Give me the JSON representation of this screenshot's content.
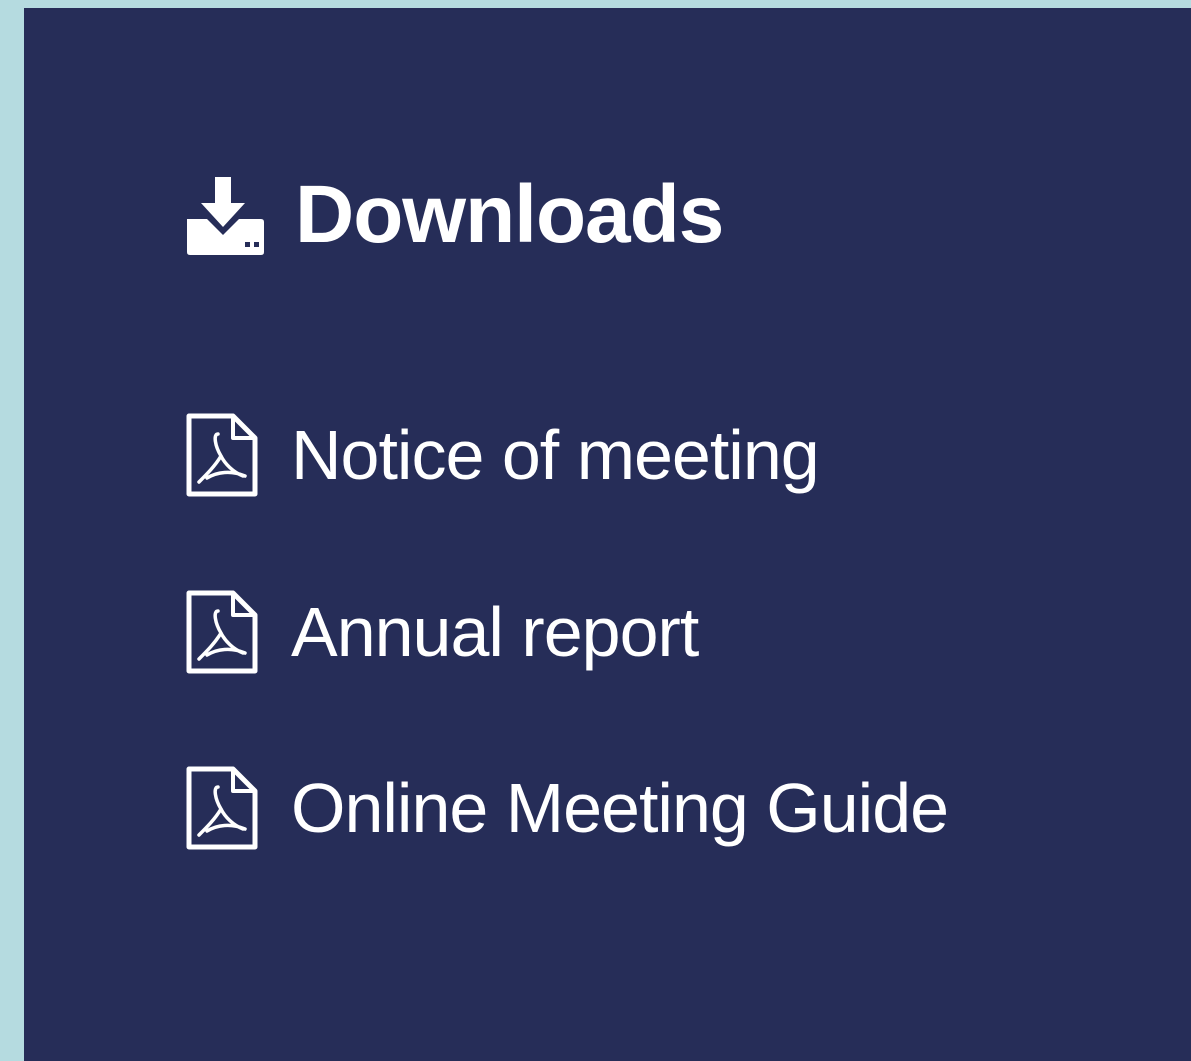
{
  "downloads": {
    "title": "Downloads",
    "icon": "download-icon",
    "items": [
      {
        "label": "Notice of meeting",
        "icon": "pdf-file-icon"
      },
      {
        "label": "Annual report",
        "icon": "pdf-file-icon"
      },
      {
        "label": "Online Meeting Guide",
        "icon": "pdf-file-icon"
      }
    ]
  },
  "colors": {
    "page_background": "#b5dbe0",
    "panel_background": "#262d58",
    "text": "#ffffff"
  }
}
